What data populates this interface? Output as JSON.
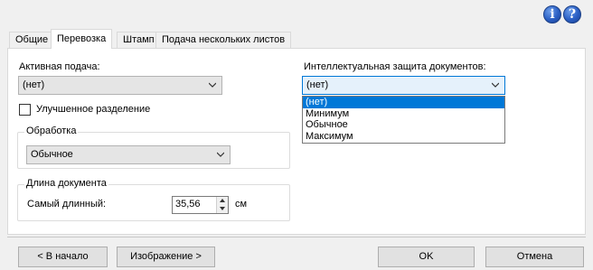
{
  "header": {
    "info_icon": "info-icon",
    "help_icon": "help-icon"
  },
  "tabs": [
    {
      "label": "Общие"
    },
    {
      "label": "Перевозка"
    },
    {
      "label": "Штамп"
    },
    {
      "label": "Подача нескольких листов"
    }
  ],
  "feed": {
    "label": "Активная подача:",
    "value": "(нет)"
  },
  "separation": {
    "label": "Улучшенное разделение",
    "checked": false
  },
  "processing": {
    "title": "Обработка",
    "value": "Обычное"
  },
  "protection": {
    "label": "Интеллектуальная защита документов:",
    "value": "(нет)",
    "options": [
      "(нет)",
      "Минимум",
      "Обычное",
      "Максимум"
    ],
    "selected_index": 0
  },
  "doc_length": {
    "title": "Длина документа",
    "longest_label": "Самый длинный:",
    "value": "35,56",
    "unit": "см"
  },
  "buttons": {
    "back": "< В начало",
    "image": "Изображение >",
    "ok": "OK",
    "cancel": "Отмена"
  },
  "colors": {
    "selection": "#0078d7",
    "icon_blue": "#2a5fc4"
  }
}
